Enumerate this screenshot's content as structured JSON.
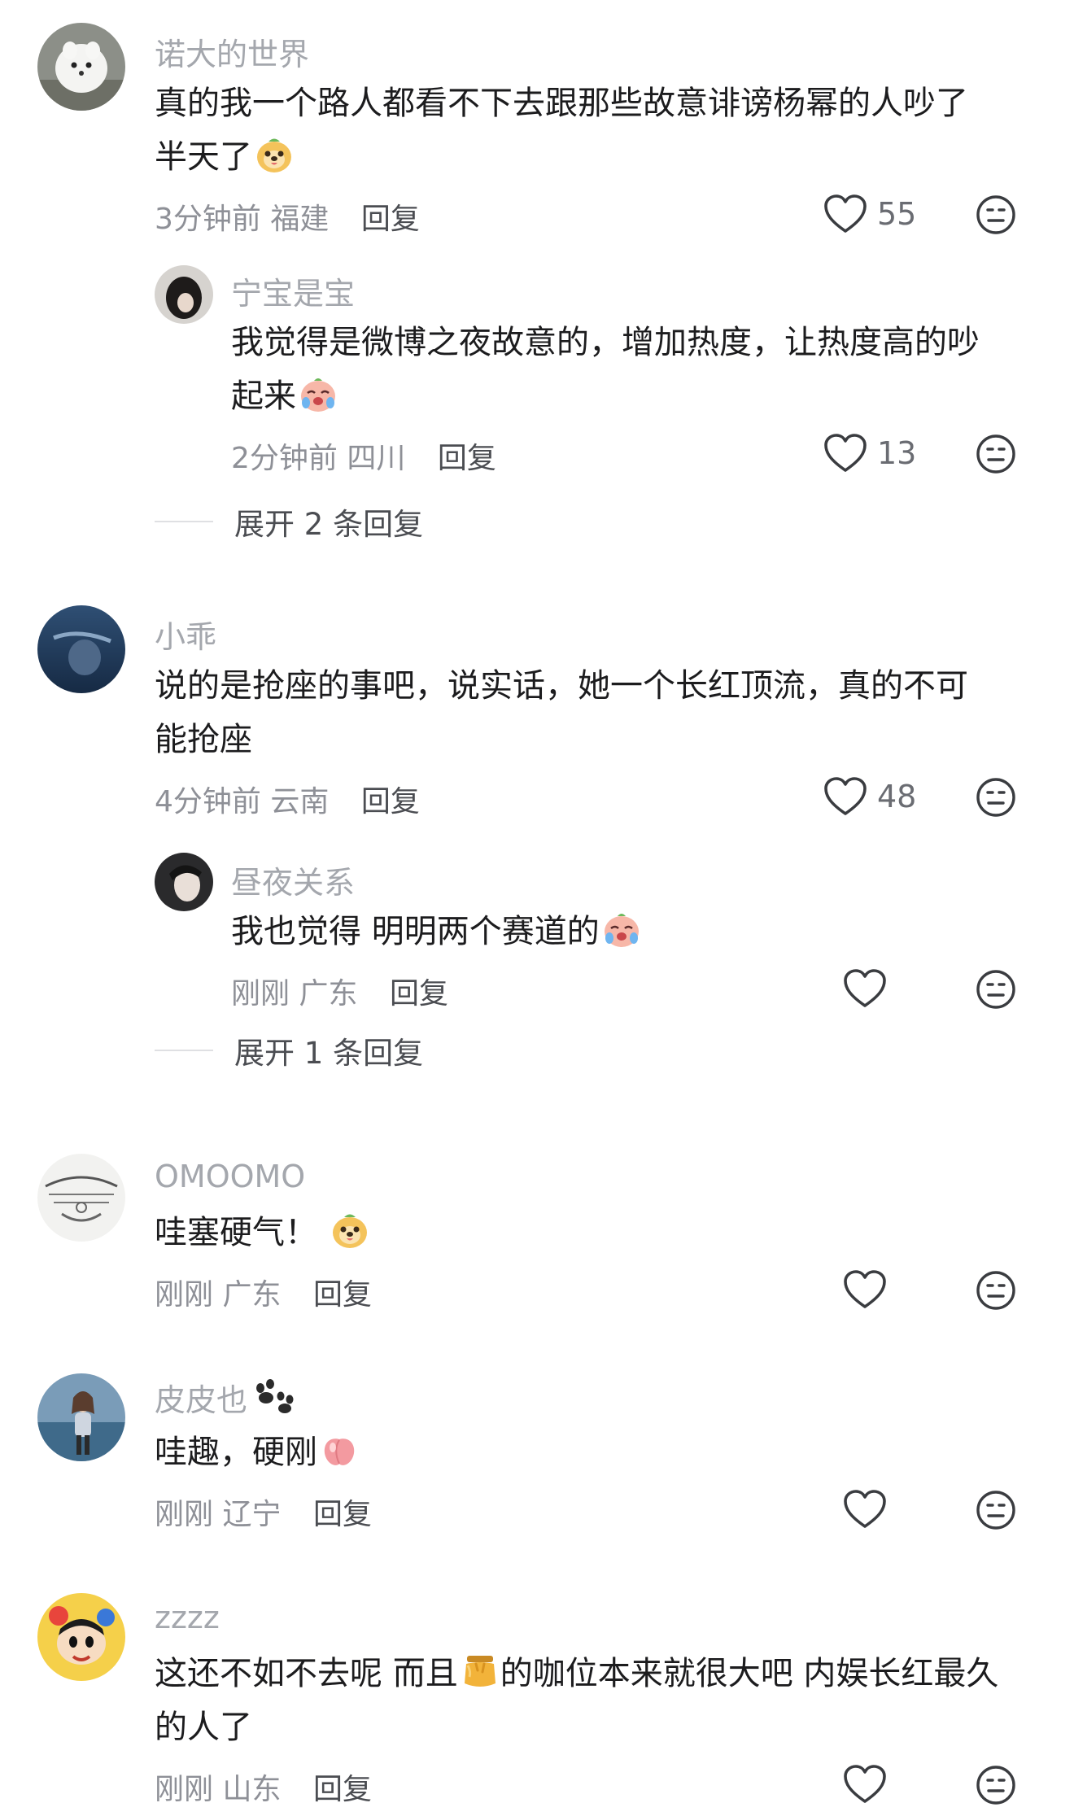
{
  "comments": [
    {
      "user": "诺大的世界",
      "text_lines": [
        "真的我一个路人都看不下去跟那些故意诽谤杨幂的人吵了",
        "半天了"
      ],
      "time": "3分钟前",
      "location": "福建",
      "reply": "回复",
      "likes": "55",
      "emoji": "doge-face",
      "replies": [
        {
          "user": "宁宝是宝",
          "text_lines": [
            "我觉得是微博之夜故意的，增加热度，让热度高的吵",
            "起来"
          ],
          "time": "2分钟前",
          "location": "四川",
          "reply": "回复",
          "likes": "13",
          "emoji": "crying-face"
        }
      ],
      "expand": "展开 2 条回复"
    },
    {
      "user": "小乖",
      "text_lines": [
        "说的是抢座的事吧，说实话，她一个长红顶流，真的不可",
        "能抢座"
      ],
      "time": "4分钟前",
      "location": "云南",
      "reply": "回复",
      "likes": "48",
      "replies": [
        {
          "user": "昼夜关系",
          "text_lines": [
            "我也觉得 明明两个赛道的"
          ],
          "time": "刚刚",
          "location": "广东",
          "reply": "回复",
          "likes": "",
          "emoji": "crying-face"
        }
      ],
      "expand": "展开 1 条回复"
    },
    {
      "user": "OMOOMO",
      "text_lines": [
        "哇塞硬气！"
      ],
      "time": "刚刚",
      "location": "广东",
      "reply": "回复",
      "likes": "",
      "emoji": "doge-face"
    },
    {
      "user": "皮皮也",
      "user_icon": "paw-icon",
      "text_lines": [
        "哇趣，硬刚"
      ],
      "time": "刚刚",
      "location": "辽宁",
      "reply": "回复",
      "likes": "",
      "emoji": "peach-icon"
    },
    {
      "user": "zzzz",
      "text_lines": [
        "这还不如不去呢 而且",
        "的咖位本来就很大吧 内娱长红最久",
        "的人了"
      ],
      "time": "刚刚",
      "location": "山东",
      "reply": "回复",
      "likes": "",
      "emoji": "honey-jar-icon"
    }
  ],
  "colors": {
    "text": "#1c1c1e",
    "meta": "#8e9097",
    "name": "#a4a7ad",
    "icon": "#3a3c40"
  }
}
